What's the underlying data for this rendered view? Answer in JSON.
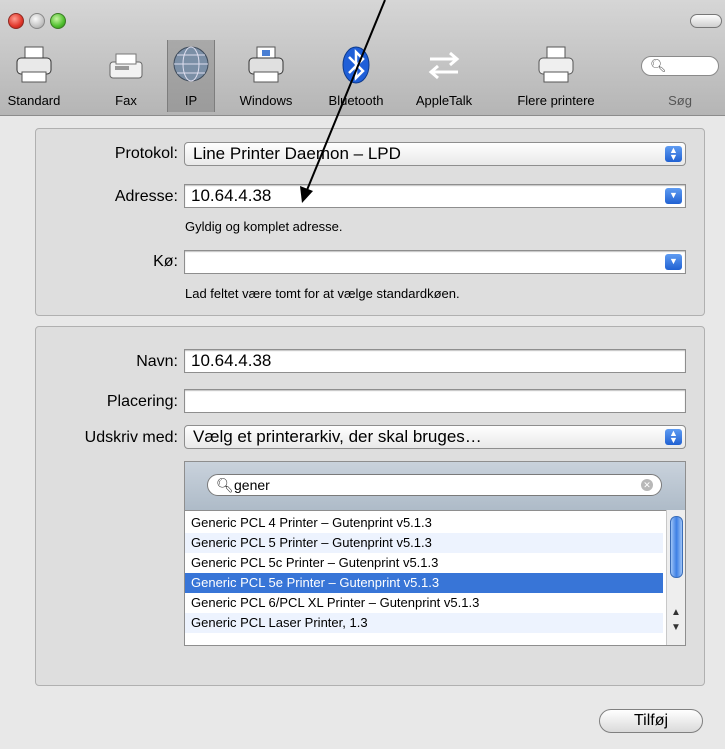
{
  "toolbar": {
    "items": [
      {
        "label": "Standard",
        "icon": "printer-icon"
      },
      {
        "label": "Fax",
        "icon": "fax-icon"
      },
      {
        "label": "IP",
        "icon": "globe-icon"
      },
      {
        "label": "Windows",
        "icon": "windows-printer-icon"
      },
      {
        "label": "Bluetooth",
        "icon": "bluetooth-icon"
      },
      {
        "label": "AppleTalk",
        "icon": "appletalk-arrows-icon"
      },
      {
        "label": "Flere printere",
        "icon": "printer-icon"
      },
      {
        "label": "Søg",
        "icon": "search-icon"
      }
    ],
    "selected": "IP"
  },
  "network": {
    "protocol_label": "Protokol:",
    "protocol_value": "Line Printer Daemon – LPD",
    "address_label": "Adresse:",
    "address_value": "10.64.4.38",
    "address_hint": "Gyldig og komplet adresse.",
    "queue_label": "Kø:",
    "queue_value": "",
    "queue_hint": "Lad feltet være tomt for at vælge standardkøen."
  },
  "details": {
    "name_label": "Navn:",
    "name_value": "10.64.4.38",
    "location_label": "Placering:",
    "location_value": "",
    "print_with_label": "Udskriv med:",
    "print_with_value": "Vælg et printerarkiv, der skal bruges…"
  },
  "driver_list": {
    "search_value": "gener",
    "items": [
      "Generic PCL 4 Printer – Gutenprint v5.1.3",
      "Generic PCL 5 Printer – Gutenprint v5.1.3",
      "Generic PCL 5c Printer – Gutenprint v5.1.3",
      "Generic PCL 5e Printer – Gutenprint v5.1.3",
      "Generic PCL 6/PCL XL Printer – Gutenprint v5.1.3",
      "Generic PCL Laser Printer, 1.3"
    ],
    "selected_index": 3
  },
  "add_button": "Tilføj",
  "colors": {
    "selection": "#3875d7",
    "accent_blue": "#2061d2"
  }
}
